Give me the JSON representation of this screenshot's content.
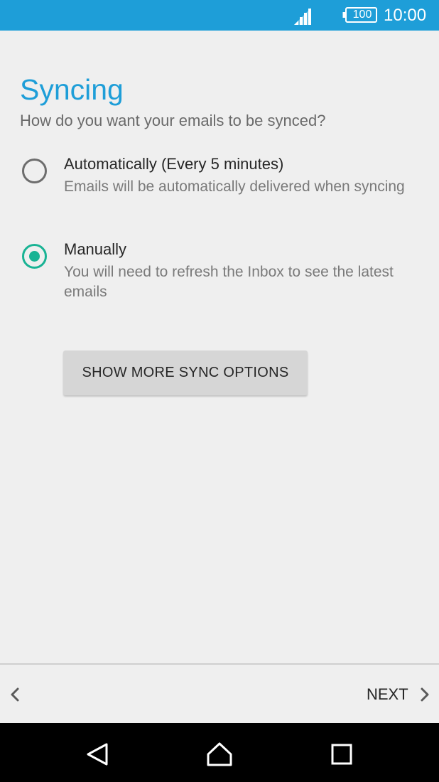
{
  "status_bar": {
    "battery_level": "100",
    "time": "10:00",
    "icons": [
      "signal-icon",
      "battery-icon"
    ]
  },
  "screen": {
    "title": "Syncing",
    "subtitle": "How do you want your emails to be synced?"
  },
  "options": [
    {
      "label": "Automatically (Every 5 minutes)",
      "description": "Emails will be automatically delivered when syncing",
      "selected": false
    },
    {
      "label": "Manually",
      "description": "You will need to refresh the Inbox to see the latest emails",
      "selected": true
    }
  ],
  "buttons": {
    "more_sync_options": "SHOW MORE SYNC OPTIONS"
  },
  "footer": {
    "next_label": "NEXT"
  },
  "colors": {
    "accent": "#1e9ed8",
    "radio_selected": "#19b394",
    "background": "#efefef"
  }
}
